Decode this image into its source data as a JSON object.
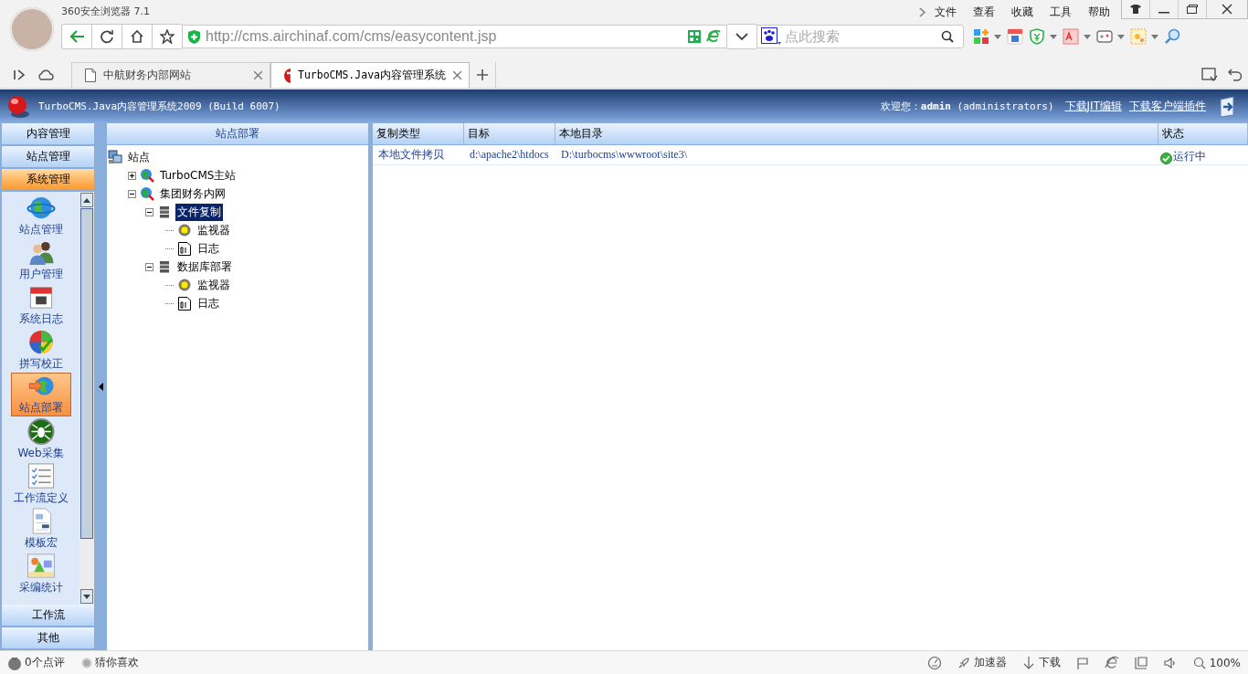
{
  "browser": {
    "title": "360安全浏览器 7.1",
    "menu": [
      "文件",
      "查看",
      "收藏",
      "工具",
      "帮助"
    ],
    "address": "http://cms.airchinaf.com/cms/easycontent.jsp",
    "search_placeholder": "点此搜索",
    "tabs": [
      {
        "label": "中航财务内部网站",
        "selected": false
      },
      {
        "label": "TurboCMS.Java内容管理系统",
        "selected": true
      }
    ]
  },
  "app_header": {
    "title": "TurboCMS.Java内容管理系统2009 (Build 6007)",
    "welcome": "欢迎您：**admin** (administrators)",
    "links": [
      "下载JIT编辑",
      "下载客户端插件"
    ]
  },
  "nav": {
    "sections_top": [
      {
        "label": "内容管理",
        "selected": false
      },
      {
        "label": "站点管理",
        "selected": false
      },
      {
        "label": "系统管理",
        "selected": true
      }
    ],
    "items": [
      {
        "label": "站点管理",
        "kind": "globe",
        "selected": false
      },
      {
        "label": "用户管理",
        "kind": "users",
        "selected": false
      },
      {
        "label": "系统日志",
        "kind": "calendar",
        "selected": false
      },
      {
        "label": "拼写校正",
        "kind": "ball",
        "selected": false
      },
      {
        "label": "站点部署",
        "kind": "deploy",
        "selected": true
      },
      {
        "label": "Web采集",
        "kind": "spider",
        "selected": false
      },
      {
        "label": "工作流定义",
        "kind": "checklist",
        "selected": false
      },
      {
        "label": "模板宏",
        "kind": "document",
        "selected": false
      },
      {
        "label": "采编统计",
        "kind": "image",
        "selected": false
      }
    ],
    "sections_bottom": [
      {
        "label": "工作流",
        "selected": false
      },
      {
        "label": "其他",
        "selected": false
      }
    ]
  },
  "tree": {
    "title": "站点部署",
    "nodes": [
      {
        "label": "站点",
        "kind": "root",
        "selected": false,
        "children": [
          {
            "label": "TurboCMS主站",
            "kind": "site",
            "expanded": false,
            "selected": false
          },
          {
            "label": "集团财务内网",
            "kind": "site",
            "expanded": true,
            "selected": false,
            "children": [
              {
                "label": "文件复制",
                "kind": "server",
                "expanded": true,
                "selected": true,
                "children": [
                  {
                    "label": "监视器",
                    "kind": "monitor",
                    "selected": false
                  },
                  {
                    "label": "日志",
                    "kind": "log",
                    "selected": false
                  }
                ]
              },
              {
                "label": "数据库部署",
                "kind": "server",
                "expanded": true,
                "selected": false,
                "children": [
                  {
                    "label": "监视器",
                    "kind": "monitor",
                    "selected": false
                  },
                  {
                    "label": "日志",
                    "kind": "log",
                    "selected": false
                  }
                ]
              }
            ]
          }
        ]
      }
    ]
  },
  "grid": {
    "columns": [
      "复制类型",
      "目标",
      "本地目录",
      "状态"
    ],
    "rows": [
      {
        "cells": [
          "本地文件拷贝",
          "d:\\apache2\\htdocs",
          "D:\\turbocms\\wwwroot\\site3\\"
        ],
        "status": "运行中",
        "running": true
      }
    ]
  },
  "status_bar": {
    "left": [
      "0个点评",
      "猜你喜欢"
    ],
    "right": [
      {
        "kind": "speed"
      },
      {
        "kind": "rocket",
        "label": "加速器"
      },
      {
        "kind": "download",
        "label": "下载"
      },
      {
        "kind": "flag"
      },
      {
        "kind": "ie"
      },
      {
        "kind": "window"
      },
      {
        "kind": "sound"
      },
      {
        "kind": "zoom",
        "label": "100%"
      }
    ]
  }
}
